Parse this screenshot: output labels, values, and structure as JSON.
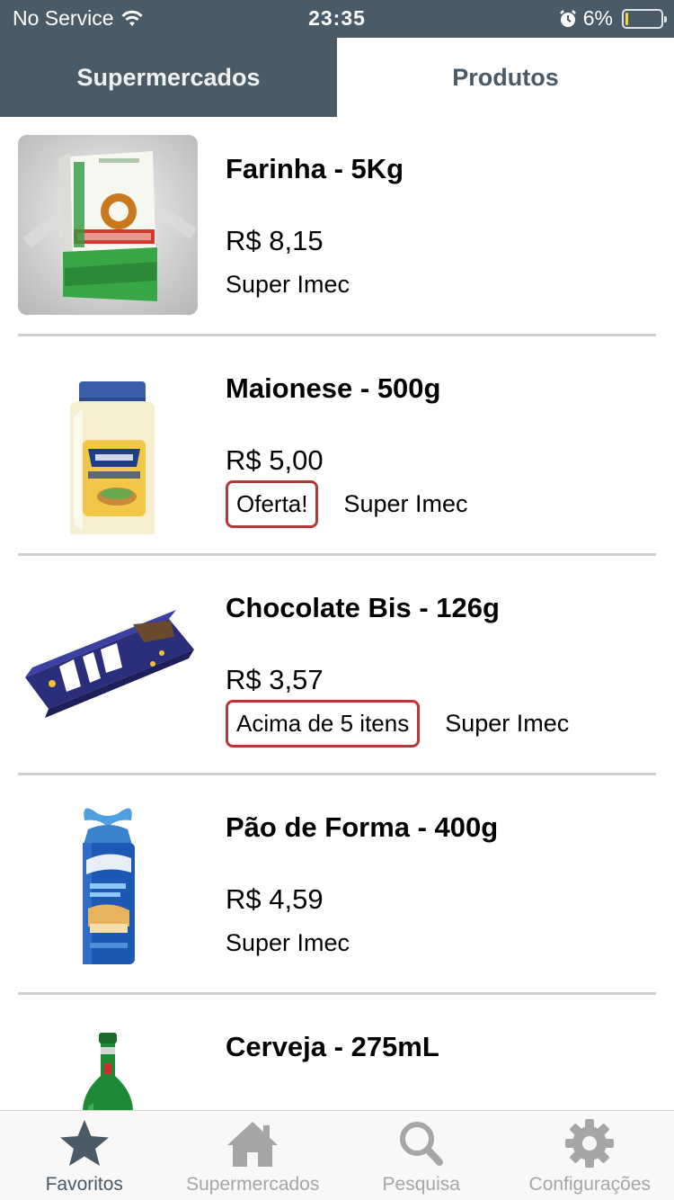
{
  "status_bar": {
    "carrier": "No Service",
    "time": "23:35",
    "battery": "6%",
    "battery_level": 0.06
  },
  "top_tabs": [
    {
      "label": "Supermercados",
      "active": false
    },
    {
      "label": "Produtos",
      "active": true
    }
  ],
  "products": [
    {
      "name": "Farinha - 5Kg",
      "price": "R$ 8,15",
      "badge": "",
      "store": "Super Imec"
    },
    {
      "name": "Maionese - 500g",
      "price": "R$ 5,00",
      "badge": "Oferta!",
      "store": "Super Imec"
    },
    {
      "name": "Chocolate Bis - 126g",
      "price": "R$ 3,57",
      "badge": "Acima de 5 itens",
      "store": "Super Imec"
    },
    {
      "name": "Pão de Forma - 400g",
      "price": "R$ 4,59",
      "badge": "",
      "store": "Super Imec"
    },
    {
      "name": "Cerveja - 275mL",
      "price": "",
      "badge": "",
      "store": ""
    }
  ],
  "bottom_tabs": [
    {
      "label": "Favoritos",
      "icon": "star-icon",
      "active": true
    },
    {
      "label": "Supermercados",
      "icon": "home-icon",
      "active": false
    },
    {
      "label": "Pesquisa",
      "icon": "search-icon",
      "active": false
    },
    {
      "label": "Configurações",
      "icon": "gear-icon",
      "active": false
    }
  ],
  "colors": {
    "primary": "#4a5a66",
    "badge_border": "#b13a36",
    "inactive_icon": "#a6a6a6"
  }
}
